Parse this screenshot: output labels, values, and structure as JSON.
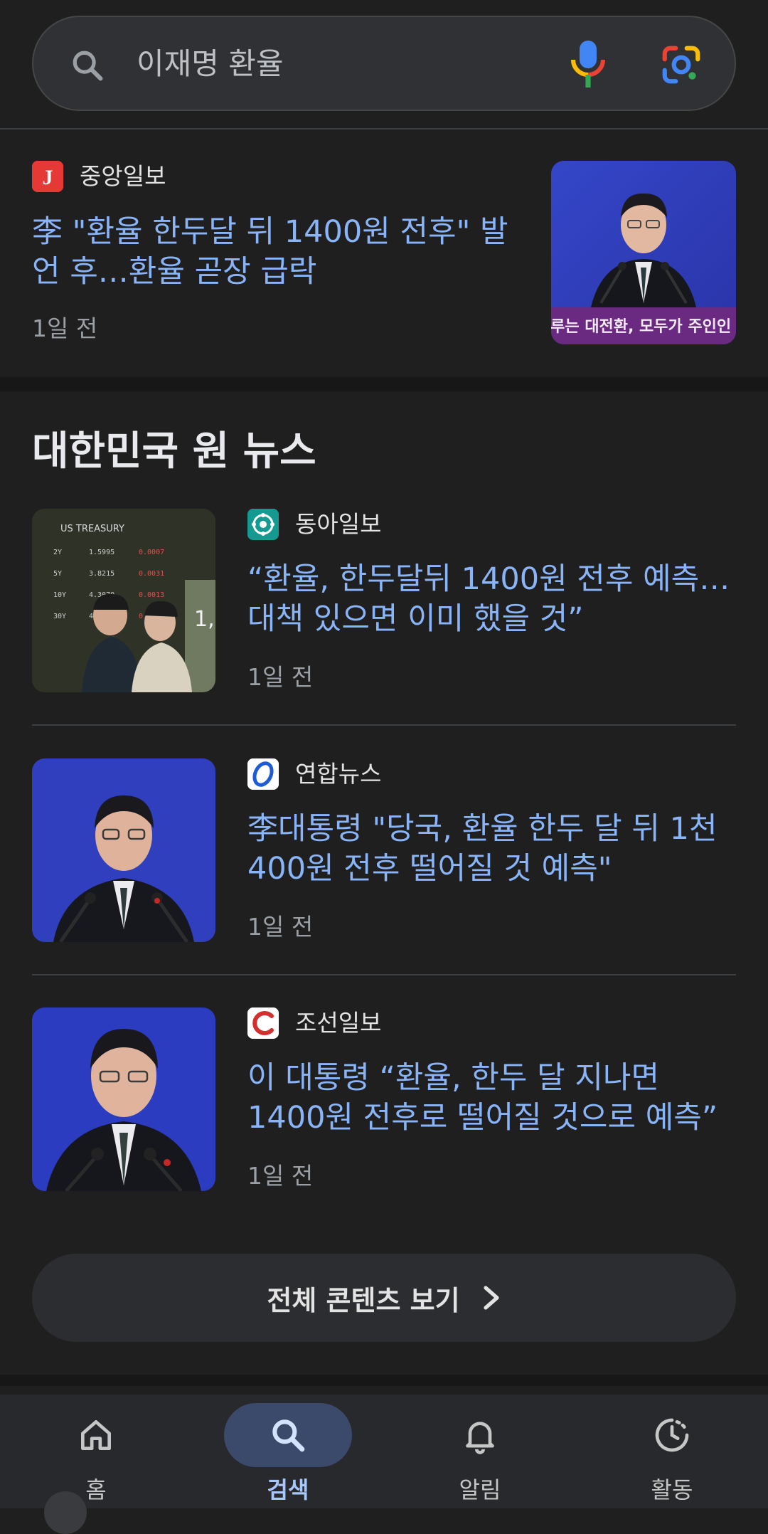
{
  "search": {
    "query": "이재명 환율"
  },
  "top_article": {
    "source": "중앙일보",
    "headline_line1": "李 \"환율 한두달 뒤 1400원 전후\" 발",
    "headline_line2": "언 후…환율 곧장 급락",
    "time": "1일 전",
    "thumbnail_caption": "이루는 대전환, 모두가 주인인 대"
  },
  "news_section": {
    "title": "대한민국 원 뉴스",
    "articles": [
      {
        "source": "동아일보",
        "headline_line1": "“환율, 한두달뒤 1400원 전후 예측…",
        "headline_line2": "대책 있으면 이미 했을 것”",
        "time": "1일 전",
        "thumbnail_label": "US TREASURY"
      },
      {
        "source": "연합뉴스",
        "headline_line1": "李대통령 \"당국, 환율 한두 달 뒤 1천",
        "headline_line2": "400원 전후 떨어질 것 예측\"",
        "time": "1일 전"
      },
      {
        "source": "조선일보",
        "headline_line1": "이 대통령 “환율, 한두 달 지나면",
        "headline_line2": "1400원 전후로 떨어질 것으로 예측”",
        "time": "1일 전"
      }
    ],
    "view_all_label": "전체 콘텐츠 보기"
  },
  "bottom_nav": {
    "items": [
      {
        "label": "홈",
        "icon": "home-icon"
      },
      {
        "label": "검색",
        "icon": "search-icon",
        "active": true
      },
      {
        "label": "알림",
        "icon": "bell-icon"
      },
      {
        "label": "활동",
        "icon": "activity-icon"
      }
    ]
  },
  "colors": {
    "background": "#1f1f1f",
    "headline": "#8ab4f8",
    "active_nav": "#a8c7fa"
  }
}
